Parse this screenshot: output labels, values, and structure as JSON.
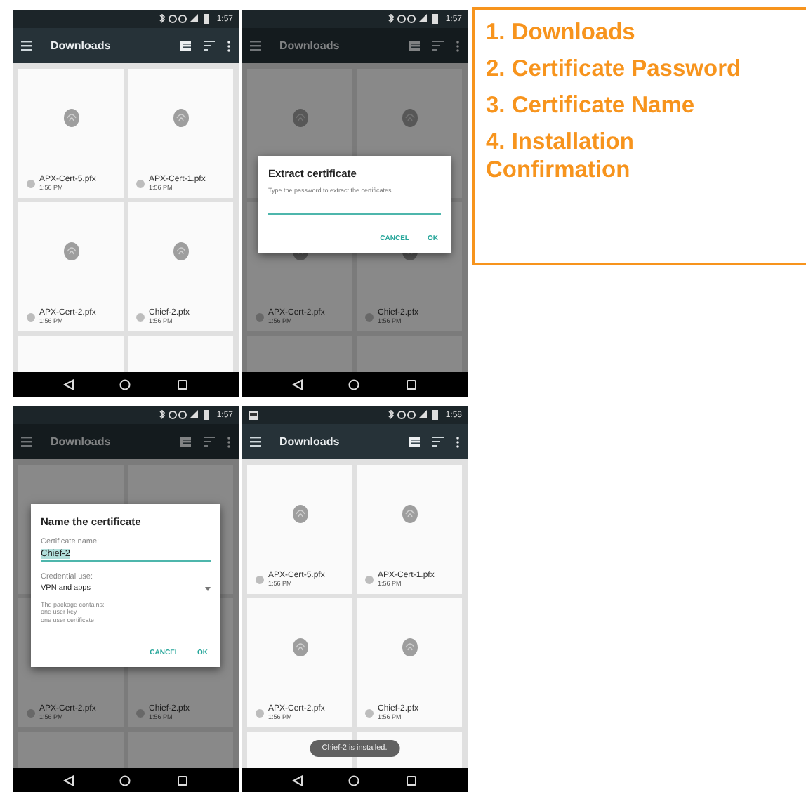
{
  "screens": [
    {
      "status_bar": {
        "time": "1:57",
        "notification_icon": false
      },
      "toolbar": {
        "title": "Downloads"
      },
      "cards": [
        {
          "kind": "file",
          "name": "APX-Cert-5.pfx",
          "time": "1:56 PM"
        },
        {
          "kind": "file",
          "name": "APX-Cert-1.pfx",
          "time": "1:56 PM"
        },
        {
          "kind": "file",
          "name": "APX-Cert-2.pfx",
          "time": "1:56 PM"
        },
        {
          "kind": "file",
          "name": "Chief-2.pfx",
          "time": "1:56 PM"
        },
        {
          "kind": "blank"
        },
        {
          "kind": "blank"
        }
      ]
    },
    {
      "status_bar": {
        "time": "1:57",
        "notification_icon": false
      },
      "toolbar": {
        "title": "Downloads"
      },
      "cards": [
        {
          "kind": "blank"
        },
        {
          "kind": "blank"
        },
        {
          "kind": "file",
          "name": "APX-Cert-2.pfx",
          "time": "1:56 PM"
        },
        {
          "kind": "file",
          "name": "Chief-2.pfx",
          "time": "1:56 PM"
        },
        {
          "kind": "blank"
        },
        {
          "kind": "blank"
        }
      ],
      "dialog": {
        "kind": "password",
        "title": "Extract certificate",
        "message": "Type the password to extract the certificates.",
        "buttons": [
          "CANCEL",
          "OK"
        ]
      }
    },
    {
      "status_bar": {
        "time": "1:57",
        "notification_icon": false
      },
      "toolbar": {
        "title": "Downloads"
      },
      "cards": [
        {
          "kind": "blank"
        },
        {
          "kind": "blank"
        },
        {
          "kind": "file",
          "name": "APX-Cert-2.pfx",
          "time": "1:56 PM"
        },
        {
          "kind": "file",
          "name": "Chief-2.pfx",
          "time": "1:56 PM"
        },
        {
          "kind": "blank"
        },
        {
          "kind": "blank"
        }
      ],
      "dialog": {
        "kind": "name",
        "title": "Name the certificate",
        "field_label": "Certificate name:",
        "value": "Chief-2",
        "select_label": "Credential use:",
        "select_value": "VPN and apps",
        "note": [
          "The package contains:",
          "one user key",
          "one user certificate"
        ],
        "buttons": [
          "CANCEL",
          "OK"
        ]
      }
    },
    {
      "status_bar": {
        "time": "1:58",
        "notification_icon": true
      },
      "toolbar": {
        "title": "Downloads"
      },
      "cards": [
        {
          "kind": "file",
          "name": "APX-Cert-5.pfx",
          "time": "1:56 PM"
        },
        {
          "kind": "file",
          "name": "APX-Cert-1.pfx",
          "time": "1:56 PM"
        },
        {
          "kind": "file",
          "name": "APX-Cert-2.pfx",
          "time": "1:56 PM"
        },
        {
          "kind": "file",
          "name": "Chief-2.pfx",
          "time": "1:56 PM"
        },
        {
          "kind": "blank"
        },
        {
          "kind": "blank"
        }
      ],
      "toast": "Chief-2 is installed."
    }
  ],
  "legend": [
    "1. Downloads",
    "2. Certificate Password",
    "3. Certificate Name",
    "4. Installation Confirmation"
  ]
}
